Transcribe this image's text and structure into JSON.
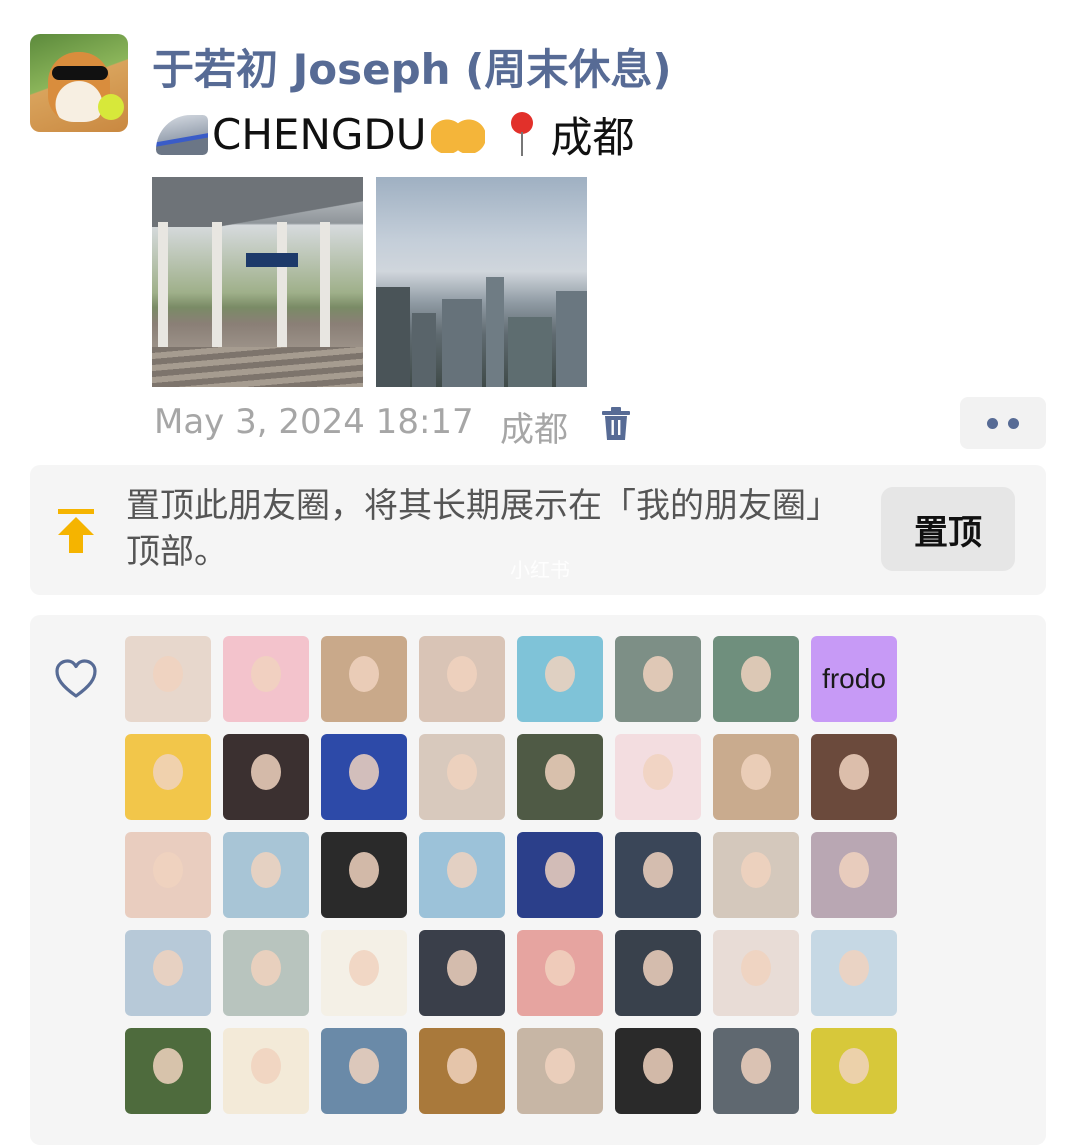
{
  "post": {
    "author": "于若初 Joseph (周末休息)",
    "text_city": "CHENGDU",
    "text_place": "成都",
    "timestamp": "May 3, 2024 18:17",
    "location": "成都",
    "icons": {
      "avatar": "shiba-dog-avatar",
      "train": "high-speed-train-emoji",
      "heart_hands": "heart-hands-emoji",
      "pin": "round-pushpin-emoji",
      "delete": "trash-icon",
      "more": "more-dots-icon"
    },
    "photos": [
      "railway-platform-photo",
      "city-skyline-photo"
    ]
  },
  "pin_prompt": {
    "text": "置顶此朋友圈，将其长期展示在「我的朋友圈」顶部。",
    "button": "置顶"
  },
  "watermark": "小红书",
  "likes": {
    "icon": "heart-outline-icon",
    "likers": [
      {
        "color": "#e7d7cc"
      },
      {
        "color": "#f3c3cc"
      },
      {
        "color": "#c9a98a"
      },
      {
        "color": "#d9c4b6"
      },
      {
        "color": "#7fc3d8"
      },
      {
        "color": "#7d8f86"
      },
      {
        "color": "#6f8f7d"
      },
      {
        "color": "#c79af6",
        "label": "frodo"
      },
      {
        "color": "#f2c64a"
      },
      {
        "color": "#3b3030"
      },
      {
        "color": "#2d4aa8"
      },
      {
        "color": "#d8c9bd"
      },
      {
        "color": "#4f5a45"
      },
      {
        "color": "#f3dde0"
      },
      {
        "color": "#c9ab8e"
      },
      {
        "color": "#6b4a3c"
      },
      {
        "color": "#e9cdbf"
      },
      {
        "color": "#a8c5d6"
      },
      {
        "color": "#2a2a2a"
      },
      {
        "color": "#9cc2d9"
      },
      {
        "color": "#2b3f8a"
      },
      {
        "color": "#3a4658"
      },
      {
        "color": "#d4c8bc"
      },
      {
        "color": "#b9a7b3"
      },
      {
        "color": "#b7c9d8"
      },
      {
        "color": "#b8c4be"
      },
      {
        "color": "#f4f0e6"
      },
      {
        "color": "#3a3f4a"
      },
      {
        "color": "#e6a4a0"
      },
      {
        "color": "#39414c"
      },
      {
        "color": "#e8dcd6"
      },
      {
        "color": "#c6d8e4"
      },
      {
        "color": "#4e6b3d"
      },
      {
        "color": "#f3ead8"
      },
      {
        "color": "#6a8aa8"
      },
      {
        "color": "#a9793b"
      },
      {
        "color": "#c7b6a5"
      },
      {
        "color": "#2a2a2a"
      },
      {
        "color": "#5f6870"
      },
      {
        "color": "#d7c83a"
      }
    ]
  }
}
